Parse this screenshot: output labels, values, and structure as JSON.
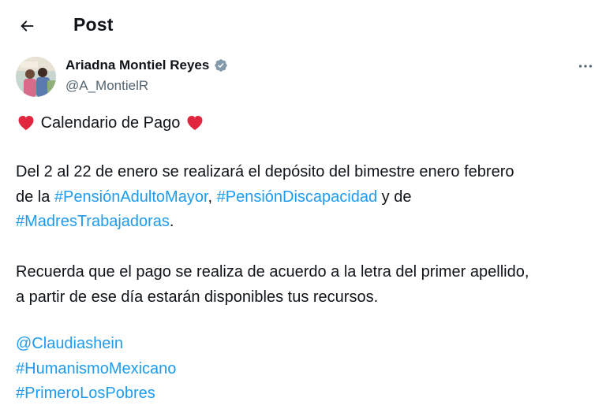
{
  "header": {
    "title": "Post"
  },
  "author": {
    "display_name": "Ariadna Montiel Reyes",
    "handle": "@A_MontielR",
    "verified_icon": "verified-badge-icon"
  },
  "post": {
    "title_line": "Calendario de Pago",
    "p1_line1": "Del 2 al 22 de enero se realizará el depósito del bimestre enero febrero",
    "p1_line2_prefix": "de la ",
    "p1_tag1": "#PensiónAdultoMayor",
    "p1_sep": ", ",
    "p1_tag2": "#PensiónDiscapacidad",
    "p1_line2_suffix": " y de",
    "p1_tag3": "#MadresTrabajadoras",
    "p1_line3_suffix": ".",
    "p2_line1": "Recuerda que el pago se realiza de acuerdo a la letra del primer apellido,",
    "p2_line2": "a partir de ese día estarán disponibles tus recursos.",
    "mention": "@Claudiashein",
    "tag_humanismo": "#HumanismoMexicano",
    "tag_primero": "#PrimeroLosPobres"
  },
  "colors": {
    "link": "#1d9bf0",
    "text": "#0f1419",
    "secondary": "#536471",
    "heart": "#f91880"
  }
}
